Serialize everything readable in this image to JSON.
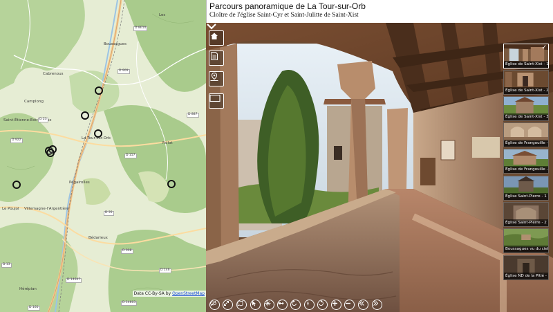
{
  "header": {
    "title": "Parcours panoramique de La Tour-sur-Orb",
    "subtitle": "Cloître de l'église Saint-Cyr et Saint-Julitte de Saint-Xist"
  },
  "map": {
    "attribution_prefix": "Data CC-By-SA by ",
    "attribution_link": "OpenStreetMap",
    "places": [
      "Les",
      "Boussagues",
      "Cabrenous",
      "Saint-Étienne-Estréchoux",
      "La Tour-sur-Orb",
      "Pégairolles",
      "Villemagne-l'Argentière",
      "Bédarieux",
      "Hérépian",
      "Le Poujol",
      "Camplong",
      "Fallot"
    ],
    "roads": [
      "D 35",
      "D 909",
      "D 922",
      "D 23",
      "D 157",
      "D 908",
      "D 146",
      "D 14603",
      "D 14607",
      "D 160",
      "D 13",
      "D 887",
      "D 8E10"
    ]
  },
  "side_buttons": [
    {
      "icon": "home-icon"
    },
    {
      "icon": "document-icon"
    },
    {
      "icon": "map-pin-icon"
    },
    {
      "icon": "fullscreen-icon"
    }
  ],
  "thumbnails": [
    {
      "label": "Église de Saint-Xist - 1",
      "active": true
    },
    {
      "label": "Église de Saint-Xist - 2",
      "active": false
    },
    {
      "label": "Église de Saint-Xist - 3",
      "active": false
    },
    {
      "label": "Église de Frangouille - 1",
      "active": false
    },
    {
      "label": "Église de Frangouille - 2",
      "active": false
    },
    {
      "label": "Église Saint-Pierre - 1",
      "active": false
    },
    {
      "label": "Église Saint-Pierre - 2",
      "active": false
    },
    {
      "label": "Boussagues vu du ciel",
      "active": false
    },
    {
      "label": "Église ND de la Pitié - 1",
      "active": false
    }
  ],
  "bottom_toolbar": [
    "hide-icon",
    "resize-icon",
    "map-view-icon",
    "cursor-icon",
    "network-icon",
    "move-icon",
    "rotate-left-icon",
    "compass-icon",
    "rotate-right-icon",
    "zoom-in-icon",
    "zoom-out-icon",
    "previous-icon",
    "next-icon"
  ],
  "colors": {
    "map_base": "#d9e6c4",
    "forest": "#a9cb8c",
    "header_bg": "#ffffff",
    "road_major": "#f4c88a",
    "marker": "#111111"
  }
}
